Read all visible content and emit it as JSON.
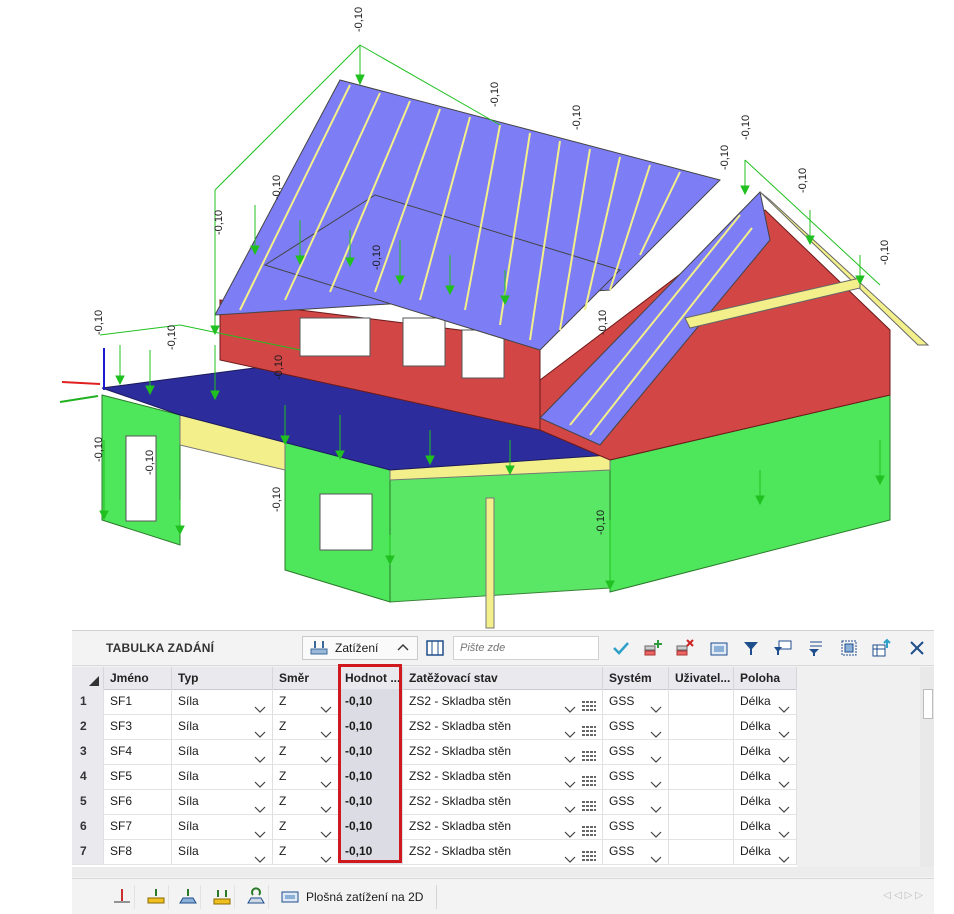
{
  "panel": {
    "title": "TABULKA ZADÁNÍ",
    "load_dropdown_label": "Zatížení",
    "search_placeholder": "Pište zde",
    "bottom_button_label": "Plošná zatížení na 2D"
  },
  "model": {
    "load_value_labels": [
      "-0,10",
      "-0,10",
      "-0,10",
      "-0,10",
      "-0,10",
      "-0,10",
      "-0,10",
      "-0,10",
      "-0,10",
      "-0,10",
      "-0,10",
      "-0,10",
      "-0,10",
      "-0,10",
      "-0,10",
      "-0,10",
      "-0,10",
      "-0,10"
    ]
  },
  "table": {
    "columns": [
      "Jméno",
      "Typ",
      "Směr",
      "Hodnot ...",
      "Zatěžovací stav",
      "Systém",
      "Uživatel...",
      "Poloha"
    ],
    "rows": [
      {
        "num": "1",
        "name": "SF1",
        "type": "Síla",
        "dir": "Z",
        "value": "-0,10",
        "case": "ZS2 - Skladba stěn",
        "system": "GSS",
        "user": "",
        "position": "Délka"
      },
      {
        "num": "2",
        "name": "SF3",
        "type": "Síla",
        "dir": "Z",
        "value": "-0,10",
        "case": "ZS2 - Skladba stěn",
        "system": "GSS",
        "user": "",
        "position": "Délka"
      },
      {
        "num": "3",
        "name": "SF4",
        "type": "Síla",
        "dir": "Z",
        "value": "-0,10",
        "case": "ZS2 - Skladba stěn",
        "system": "GSS",
        "user": "",
        "position": "Délka"
      },
      {
        "num": "4",
        "name": "SF5",
        "type": "Síla",
        "dir": "Z",
        "value": "-0,10",
        "case": "ZS2 - Skladba stěn",
        "system": "GSS",
        "user": "",
        "position": "Délka"
      },
      {
        "num": "5",
        "name": "SF6",
        "type": "Síla",
        "dir": "Z",
        "value": "-0,10",
        "case": "ZS2 - Skladba stěn",
        "system": "GSS",
        "user": "",
        "position": "Délka"
      },
      {
        "num": "6",
        "name": "SF7",
        "type": "Síla",
        "dir": "Z",
        "value": "-0,10",
        "case": "ZS2 - Skladba stěn",
        "system": "GSS",
        "user": "",
        "position": "Délka"
      },
      {
        "num": "7",
        "name": "SF8",
        "type": "Síla",
        "dir": "Z",
        "value": "-0,10",
        "case": "ZS2 - Skladba stěn",
        "system": "GSS",
        "user": "",
        "position": "Délka"
      }
    ]
  },
  "colors": {
    "wall_upper": "#d24646",
    "wall_lower": "#4ee65a",
    "roof": "#7d7df5",
    "slab": "#2c2c9c",
    "beam": "#f3ef8a",
    "load": "#20c020",
    "highlight": "#d0191f"
  },
  "icons": [
    "load-case-icon",
    "columns-icon",
    "check-icon",
    "add-row-icon",
    "delete-row-icon",
    "library-icon",
    "filter-icon",
    "filter-comment-icon",
    "sort-filter-icon",
    "select-all-icon",
    "export-icon",
    "close-icon"
  ]
}
